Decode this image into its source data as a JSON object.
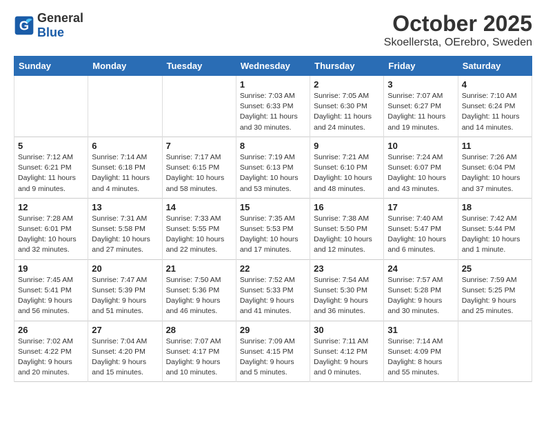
{
  "header": {
    "logo_general": "General",
    "logo_blue": "Blue",
    "month": "October 2025",
    "location": "Skoellersta, OErebro, Sweden"
  },
  "weekdays": [
    "Sunday",
    "Monday",
    "Tuesday",
    "Wednesday",
    "Thursday",
    "Friday",
    "Saturday"
  ],
  "weeks": [
    [
      {
        "day": "",
        "info": ""
      },
      {
        "day": "",
        "info": ""
      },
      {
        "day": "",
        "info": ""
      },
      {
        "day": "1",
        "info": "Sunrise: 7:03 AM\nSunset: 6:33 PM\nDaylight: 11 hours\nand 30 minutes."
      },
      {
        "day": "2",
        "info": "Sunrise: 7:05 AM\nSunset: 6:30 PM\nDaylight: 11 hours\nand 24 minutes."
      },
      {
        "day": "3",
        "info": "Sunrise: 7:07 AM\nSunset: 6:27 PM\nDaylight: 11 hours\nand 19 minutes."
      },
      {
        "day": "4",
        "info": "Sunrise: 7:10 AM\nSunset: 6:24 PM\nDaylight: 11 hours\nand 14 minutes."
      }
    ],
    [
      {
        "day": "5",
        "info": "Sunrise: 7:12 AM\nSunset: 6:21 PM\nDaylight: 11 hours\nand 9 minutes."
      },
      {
        "day": "6",
        "info": "Sunrise: 7:14 AM\nSunset: 6:18 PM\nDaylight: 11 hours\nand 4 minutes."
      },
      {
        "day": "7",
        "info": "Sunrise: 7:17 AM\nSunset: 6:15 PM\nDaylight: 10 hours\nand 58 minutes."
      },
      {
        "day": "8",
        "info": "Sunrise: 7:19 AM\nSunset: 6:13 PM\nDaylight: 10 hours\nand 53 minutes."
      },
      {
        "day": "9",
        "info": "Sunrise: 7:21 AM\nSunset: 6:10 PM\nDaylight: 10 hours\nand 48 minutes."
      },
      {
        "day": "10",
        "info": "Sunrise: 7:24 AM\nSunset: 6:07 PM\nDaylight: 10 hours\nand 43 minutes."
      },
      {
        "day": "11",
        "info": "Sunrise: 7:26 AM\nSunset: 6:04 PM\nDaylight: 10 hours\nand 37 minutes."
      }
    ],
    [
      {
        "day": "12",
        "info": "Sunrise: 7:28 AM\nSunset: 6:01 PM\nDaylight: 10 hours\nand 32 minutes."
      },
      {
        "day": "13",
        "info": "Sunrise: 7:31 AM\nSunset: 5:58 PM\nDaylight: 10 hours\nand 27 minutes."
      },
      {
        "day": "14",
        "info": "Sunrise: 7:33 AM\nSunset: 5:55 PM\nDaylight: 10 hours\nand 22 minutes."
      },
      {
        "day": "15",
        "info": "Sunrise: 7:35 AM\nSunset: 5:53 PM\nDaylight: 10 hours\nand 17 minutes."
      },
      {
        "day": "16",
        "info": "Sunrise: 7:38 AM\nSunset: 5:50 PM\nDaylight: 10 hours\nand 12 minutes."
      },
      {
        "day": "17",
        "info": "Sunrise: 7:40 AM\nSunset: 5:47 PM\nDaylight: 10 hours\nand 6 minutes."
      },
      {
        "day": "18",
        "info": "Sunrise: 7:42 AM\nSunset: 5:44 PM\nDaylight: 10 hours\nand 1 minute."
      }
    ],
    [
      {
        "day": "19",
        "info": "Sunrise: 7:45 AM\nSunset: 5:41 PM\nDaylight: 9 hours\nand 56 minutes."
      },
      {
        "day": "20",
        "info": "Sunrise: 7:47 AM\nSunset: 5:39 PM\nDaylight: 9 hours\nand 51 minutes."
      },
      {
        "day": "21",
        "info": "Sunrise: 7:50 AM\nSunset: 5:36 PM\nDaylight: 9 hours\nand 46 minutes."
      },
      {
        "day": "22",
        "info": "Sunrise: 7:52 AM\nSunset: 5:33 PM\nDaylight: 9 hours\nand 41 minutes."
      },
      {
        "day": "23",
        "info": "Sunrise: 7:54 AM\nSunset: 5:30 PM\nDaylight: 9 hours\nand 36 minutes."
      },
      {
        "day": "24",
        "info": "Sunrise: 7:57 AM\nSunset: 5:28 PM\nDaylight: 9 hours\nand 30 minutes."
      },
      {
        "day": "25",
        "info": "Sunrise: 7:59 AM\nSunset: 5:25 PM\nDaylight: 9 hours\nand 25 minutes."
      }
    ],
    [
      {
        "day": "26",
        "info": "Sunrise: 7:02 AM\nSunset: 4:22 PM\nDaylight: 9 hours\nand 20 minutes."
      },
      {
        "day": "27",
        "info": "Sunrise: 7:04 AM\nSunset: 4:20 PM\nDaylight: 9 hours\nand 15 minutes."
      },
      {
        "day": "28",
        "info": "Sunrise: 7:07 AM\nSunset: 4:17 PM\nDaylight: 9 hours\nand 10 minutes."
      },
      {
        "day": "29",
        "info": "Sunrise: 7:09 AM\nSunset: 4:15 PM\nDaylight: 9 hours\nand 5 minutes."
      },
      {
        "day": "30",
        "info": "Sunrise: 7:11 AM\nSunset: 4:12 PM\nDaylight: 9 hours\nand 0 minutes."
      },
      {
        "day": "31",
        "info": "Sunrise: 7:14 AM\nSunset: 4:09 PM\nDaylight: 8 hours\nand 55 minutes."
      },
      {
        "day": "",
        "info": ""
      }
    ]
  ]
}
